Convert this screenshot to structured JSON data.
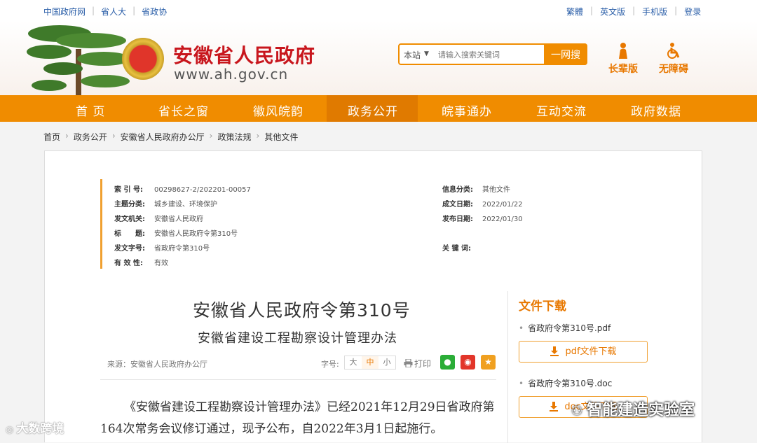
{
  "toplinks": [
    "中国政府网",
    "省人大",
    "省政协"
  ],
  "rightlinks": [
    "繁體",
    "英文版",
    "手机版",
    "登录"
  ],
  "site": {
    "name": "安徽省人民政府",
    "url": "www.ah.gov.cn"
  },
  "search": {
    "scope": "本站",
    "placeholder": "请输入搜索关键词",
    "button": "一网搜"
  },
  "modes": {
    "elder": "长辈版",
    "accessible": "无障碍"
  },
  "nav": [
    "首 页",
    "省长之窗",
    "徽风皖韵",
    "政务公开",
    "皖事通办",
    "互动交流",
    "政府数据"
  ],
  "nav_active": "政务公开",
  "breadcrumb": [
    "首页",
    "政务公开",
    "安徽省人民政府办公厅",
    "政策法规",
    "其他文件"
  ],
  "meta": {
    "index_k": "索 引 号:",
    "index_v": "00298627-2/202201-00057",
    "topic_k": "主题分类:",
    "topic_v": "城乡建设、环境保护",
    "issuer_k": "发文机关:",
    "issuer_v": "安徽省人民政府",
    "title_k": "标　　题:",
    "title_v": "安徽省人民政府令第310号",
    "docno_k": "发文字号:",
    "docno_v": "省政府令第310号",
    "valid_k": "有 效 性:",
    "valid_v": "有效",
    "cat_k": "信息分类:",
    "cat_v": "其他文件",
    "written_k": "成文日期:",
    "written_v": "2022/01/22",
    "pub_k": "发布日期:",
    "pub_v": "2022/01/30",
    "kw_k": "关 键 词:",
    "kw_v": ""
  },
  "doc": {
    "title": "安徽省人民政府令第310号",
    "subtitle": "安徽省建设工程勘察设计管理办法",
    "source": "来源：安徽省人民政府办公厅",
    "fontsize_label": "字号:",
    "sizes": [
      "大",
      "中",
      "小"
    ],
    "print": "打印",
    "body": "《安徽省建设工程勘察设计管理办法》已经2021年12月29日省政府第164次常务会议修订通过，现予公布，自2022年3月1日起施行。"
  },
  "downloads": {
    "title": "文件下载",
    "files": [
      {
        "name": "省政府令第310号.pdf",
        "button": "pdf文件下载"
      },
      {
        "name": "省政府令第310号.doc",
        "button": "doc文件下载"
      }
    ]
  },
  "watermarks": {
    "left": "大数跨境",
    "right": "智能建造实验室"
  },
  "colors": {
    "accent": "#f08c00",
    "brand_red": "#c8161d",
    "link": "#2a5ea8"
  }
}
